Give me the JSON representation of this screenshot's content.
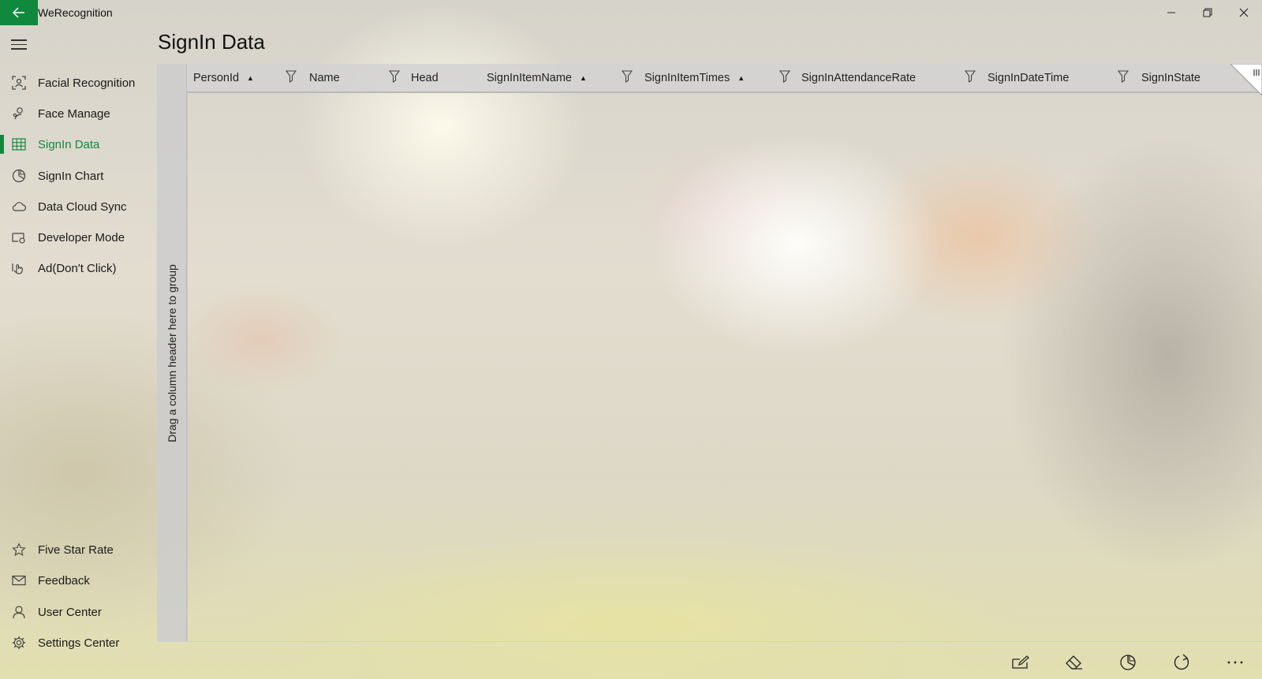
{
  "titlebar": {
    "app_title": "WeRecognition",
    "back_icon": "arrow-left-icon",
    "accent": "#10893e",
    "controls": [
      "minimize-icon",
      "restore-icon",
      "close-icon"
    ]
  },
  "sidebar": {
    "menu_icon": "hamburger-icon",
    "items": [
      {
        "label": "Facial Recognition",
        "icon": "face-scan-icon"
      },
      {
        "label": "Face Manage",
        "icon": "person-manage-icon"
      },
      {
        "label": "SignIn Data",
        "icon": "grid-table-icon",
        "active": true
      },
      {
        "label": "SignIn Chart",
        "icon": "pie-chart-icon"
      },
      {
        "label": "Data Cloud Sync",
        "icon": "cloud-icon"
      },
      {
        "label": "Developer Mode",
        "icon": "developer-icon"
      },
      {
        "label": "Ad(Don't Click)",
        "icon": "hand-icon"
      }
    ],
    "footer_items": [
      {
        "label": "Five Star Rate",
        "icon": "star-icon"
      },
      {
        "label": "Feedback",
        "icon": "mail-icon"
      },
      {
        "label": "User Center",
        "icon": "user-icon"
      },
      {
        "label": "Settings Center",
        "icon": "gear-icon"
      }
    ]
  },
  "page": {
    "title": "SignIn Data"
  },
  "grid": {
    "group_panel_text": "Drag a column header here to group",
    "columns": [
      {
        "label": "PersonId",
        "sort": "▲"
      },
      {
        "label": "Name",
        "sort": ""
      },
      {
        "label": "Head",
        "sort": ""
      },
      {
        "label": "SignInItemName",
        "sort": "▲"
      },
      {
        "label": "SignInItemTimes",
        "sort": "▲"
      },
      {
        "label": "SignInAttendanceRate",
        "sort": ""
      },
      {
        "label": "SignInDateTime",
        "sort": ""
      },
      {
        "label": "SignInState",
        "sort": ""
      }
    ],
    "rows": []
  },
  "command_bar": {
    "buttons": [
      "edit-icon",
      "eraser-icon",
      "pie-chart-icon",
      "refresh-icon",
      "more-icon"
    ]
  }
}
